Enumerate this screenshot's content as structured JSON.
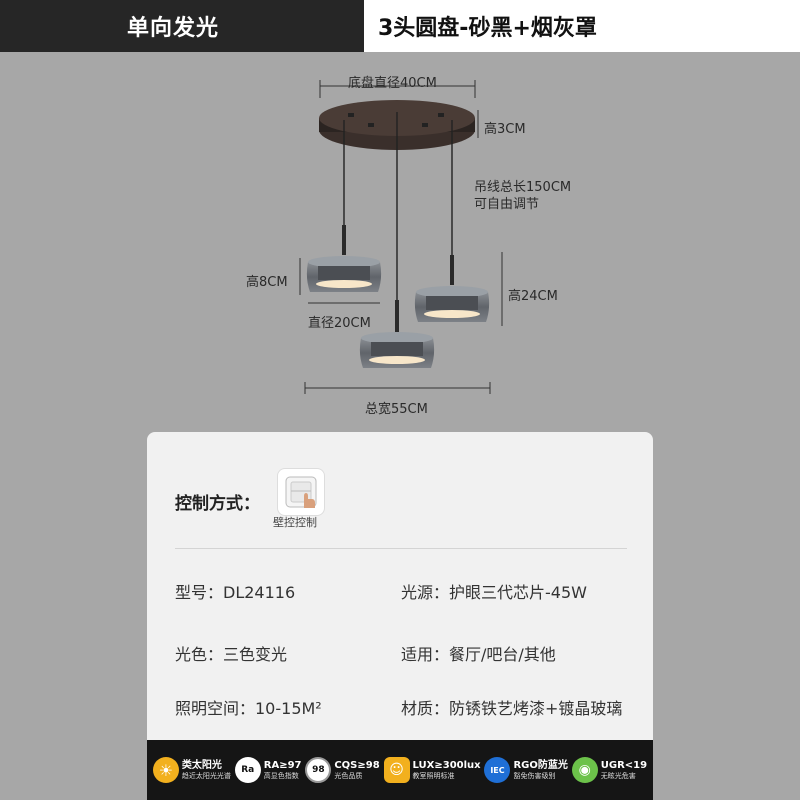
{
  "header": {
    "left_title": "单向发光",
    "right_title": "3头圆盘-砂黑+烟灰罩"
  },
  "dimensions": {
    "base_diameter": "底盘直径40CM",
    "base_height": "高3CM",
    "cable_length": "吊线总长150CM",
    "cable_adjust": "可自由调节",
    "shade_height": "高8CM",
    "shade_diameter": "直径20CM",
    "drop_height": "高24CM",
    "total_width": "总宽55CM"
  },
  "control": {
    "label": "控制方式：",
    "switch_caption": "壁控控制"
  },
  "specs": {
    "model": "型号：DL24116",
    "light_source": "光源：护眼三代芯片-45W",
    "light_color": "光色：三色变光",
    "applicable": "适用：餐厅/吧台/其他",
    "lighting_space": "照明空间：10-15M²",
    "material": "材质：防锈铁艺烤漆+镀晶玻璃"
  },
  "badges": [
    {
      "icon": "sun-icon",
      "title": "类太阳光",
      "sub": "趋近太阳光光谱",
      "color": "#f2b01e"
    },
    {
      "icon": "ra-icon",
      "glyph": "Ra",
      "title": "RA≥97",
      "sub": "高显色指数",
      "color": "#ffffff"
    },
    {
      "icon": "cqs-icon",
      "glyph": "98",
      "title": "CQS≥98",
      "sub": "光色品质",
      "color": "#ffffff"
    },
    {
      "icon": "lux-icon",
      "glyph": "☺",
      "title": "LUX≥300lux",
      "sub": "教室照明标准",
      "color": "#f2b01e"
    },
    {
      "icon": "iec-icon",
      "glyph": "IEC",
      "title": "RGO防蓝光",
      "sub": "豁免伤害级别",
      "color": "#1f6fd6"
    },
    {
      "icon": "eye-icon",
      "glyph": "◉",
      "title": "UGR<19",
      "sub": "无眩光危害",
      "color": "#6cc24a"
    }
  ]
}
